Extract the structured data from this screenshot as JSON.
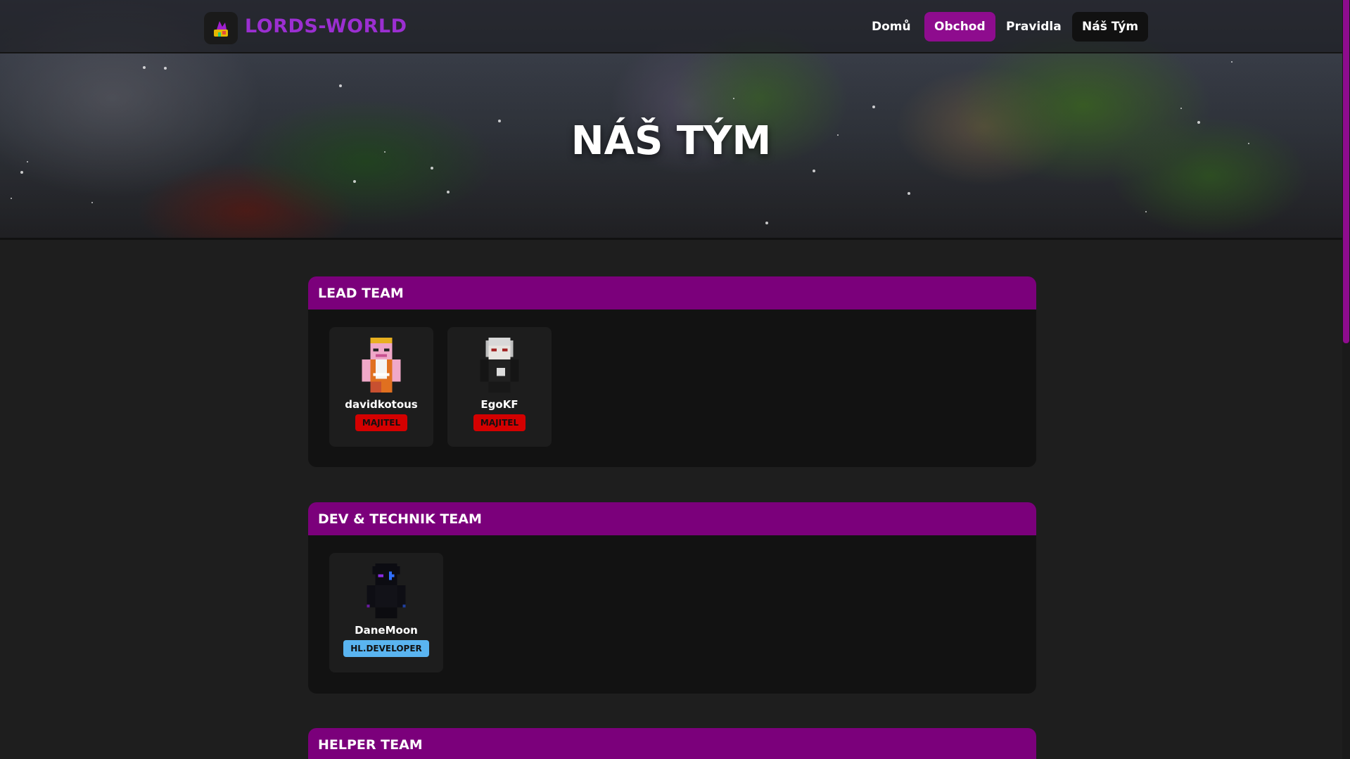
{
  "brand": {
    "name": "LORDS-WORLD"
  },
  "nav": {
    "items": [
      {
        "label": "Domů"
      },
      {
        "label": "Obchod"
      },
      {
        "label": "Pravidla"
      },
      {
        "label": "Náš Tým"
      }
    ],
    "active_color": "#8e0c8e"
  },
  "hero": {
    "title": "NÁŠ TÝM"
  },
  "sections": [
    {
      "title": "LEAD TEAM",
      "members": [
        {
          "name": "davidkotous",
          "rank": "MAJITEL",
          "rank_color": "#d40000"
        },
        {
          "name": "EgoKF",
          "rank": "MAJITEL",
          "rank_color": "#d40000"
        }
      ]
    },
    {
      "title": "DEV & TECHNIK TEAM",
      "members": [
        {
          "name": "DaneMoon",
          "rank": "HL.DEVELOPER",
          "rank_color": "#5ab4f0"
        }
      ]
    },
    {
      "title": "HELPER TEAM",
      "members": []
    }
  ],
  "colors": {
    "section_header": "#7b007b",
    "background": "#1e1e1e"
  }
}
